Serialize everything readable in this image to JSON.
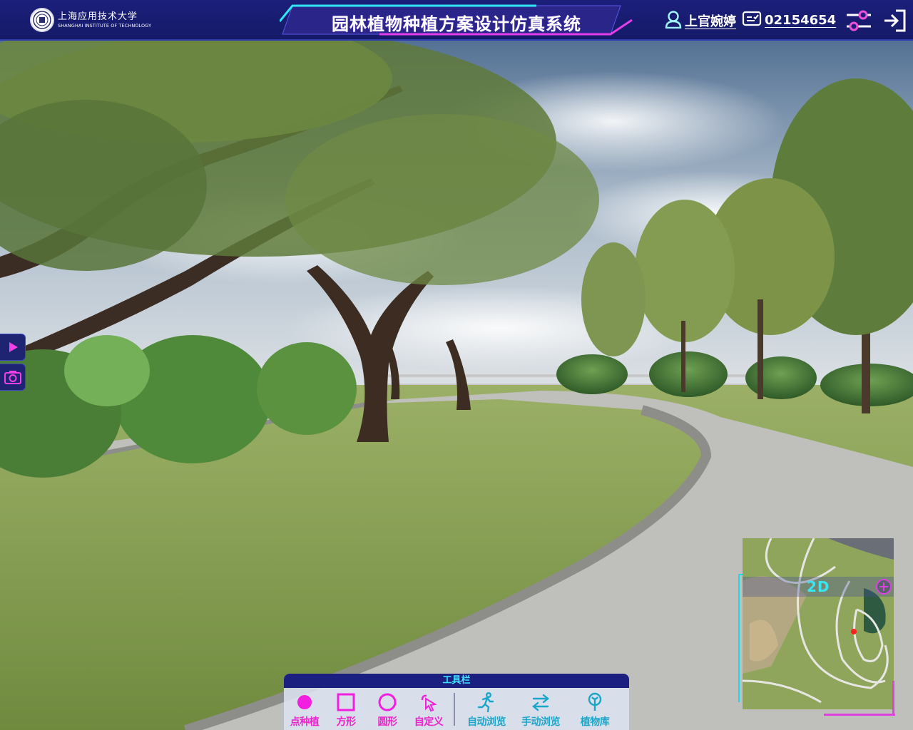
{
  "header": {
    "logo": {
      "name_cn": "上海应用技术大学",
      "name_en": "SHANGHAI INSTITUTE OF TECHNOLOGY",
      "icon": "university-seal-icon"
    },
    "title": "园林植物种植方案设计仿真系统",
    "user": {
      "name": "上官婉婷",
      "icon": "user-icon"
    },
    "student_id": {
      "value": "02154654",
      "icon": "id-card-icon"
    },
    "settings_icon": "sliders-icon",
    "logout_icon": "logout-icon"
  },
  "side_tabs": [
    {
      "icon": "play-icon"
    },
    {
      "icon": "camera-icon"
    }
  ],
  "minimap": {
    "mode_label": "2D",
    "zoom_icon": "zoom-in-icon"
  },
  "toolbar": {
    "title": "工具栏",
    "draw_tools": [
      {
        "label": "点种植",
        "icon": "filled-circle-icon"
      },
      {
        "label": "方形",
        "icon": "square-icon"
      },
      {
        "label": "圆形",
        "icon": "circle-icon"
      },
      {
        "label": "自定义",
        "icon": "cursor-icon"
      }
    ],
    "nav_tools": [
      {
        "label": "自动浏览",
        "icon": "running-person-icon"
      },
      {
        "label": "手动浏览",
        "icon": "swap-arrows-icon"
      },
      {
        "label": "植物库",
        "icon": "plant-library-icon"
      }
    ]
  },
  "colors": {
    "header_bg": "#1b1f7a",
    "accent_cyan": "#1fd8e8",
    "accent_magenta": "#e040e0",
    "draw_tool": "#ee22cc",
    "nav_tool": "#1aa6c8"
  }
}
